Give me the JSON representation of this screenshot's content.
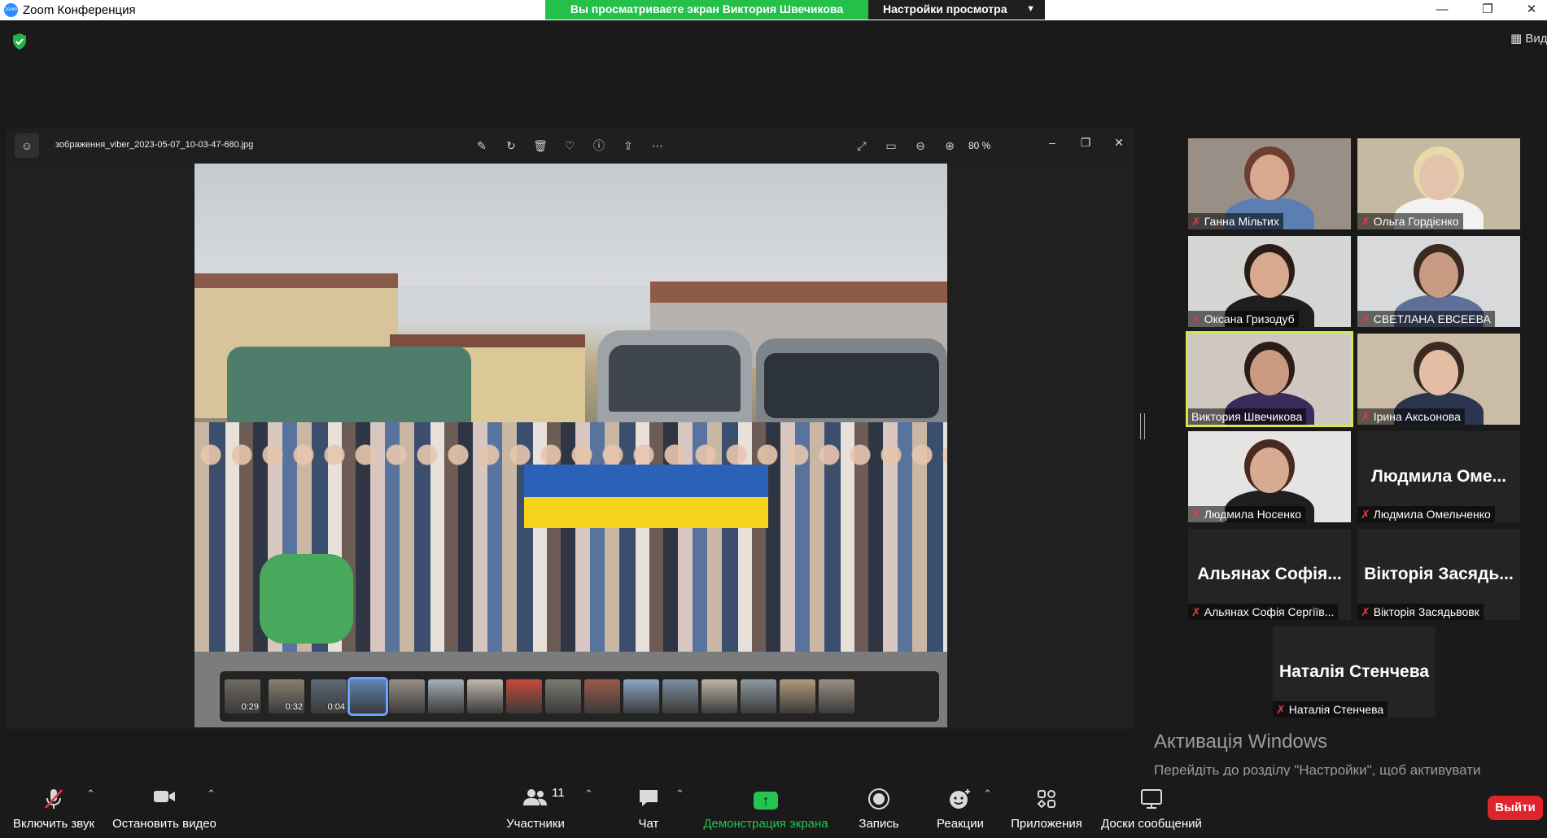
{
  "window": {
    "title": "Zoom Конференция",
    "logo_text": "zoom",
    "minimize": "—",
    "restore": "❐",
    "close": "✕"
  },
  "share": {
    "banner": "Вы просматриваете экран Виктория Швечикова",
    "view_options": "Настройки просмотра"
  },
  "top_right": {
    "view_label": "Вид"
  },
  "viewer": {
    "filename": "зображення_viber_2023-05-07_10-03-47-680.jpg",
    "zoom": "80 %",
    "thumbnails": [
      {
        "label": "0:29",
        "color": "#6f6a63",
        "selected": false
      },
      {
        "label": "0:32",
        "color": "#8b7f70",
        "selected": false
      },
      {
        "label": "0:04",
        "color": "#5d6a76",
        "selected": false
      },
      {
        "label": "",
        "color": "#5f84b4",
        "selected": true
      },
      {
        "label": "",
        "color": "#9a8f87",
        "selected": false
      },
      {
        "label": "",
        "color": "#a7b0b8",
        "selected": false
      },
      {
        "label": "",
        "color": "#bfb8ad",
        "selected": false
      },
      {
        "label": "",
        "color": "#c7493c",
        "selected": false
      },
      {
        "label": "",
        "color": "#7d7a73",
        "selected": false
      },
      {
        "label": "",
        "color": "#9a5b4a",
        "selected": false
      },
      {
        "label": "",
        "color": "#8da6c7",
        "selected": false
      },
      {
        "label": "",
        "color": "#7c8ea0",
        "selected": false
      },
      {
        "label": "",
        "color": "#c0b3a4",
        "selected": false
      },
      {
        "label": "",
        "color": "#8e9aa0",
        "selected": false
      },
      {
        "label": "",
        "color": "#b09a7c",
        "selected": false
      },
      {
        "label": "",
        "color": "#9b8f83",
        "selected": false
      }
    ]
  },
  "participants": [
    {
      "name": "Ганна Мільтих",
      "muted": true,
      "video": true,
      "bg": "#9a8f86",
      "face": "#d9a98f",
      "hair": "#6b3e2f",
      "body": "#5a7fb0"
    },
    {
      "name": "Ольга Гордієнко",
      "muted": true,
      "video": true,
      "bg": "#c6b9a4",
      "face": "#e4c3ad",
      "hair": "#e8d9a8",
      "body": "#f2f2f2"
    },
    {
      "name": "Оксана Гризодуб",
      "muted": true,
      "video": true,
      "bg": "#d6d6d4",
      "face": "#d8a98f",
      "hair": "#2b1c18",
      "body": "#1e1e1e"
    },
    {
      "name": "СВЕТЛАНА ЕВСЕЕВА",
      "muted": true,
      "video": true,
      "bg": "#d8d9da",
      "face": "#c79c82",
      "hair": "#3a2a22",
      "body": "#5e6f9a"
    },
    {
      "name": "Виктория Швечикова",
      "muted": false,
      "video": true,
      "speaking": true,
      "bg": "#cfc8c0",
      "face": "#c99a80",
      "hair": "#2c1c17",
      "body": "#3b2b5a"
    },
    {
      "name": "Ірина Аксьонова",
      "muted": true,
      "video": true,
      "bg": "#cbbca8",
      "face": "#e3bea4",
      "hair": "#3b2a22",
      "body": "#2c3550"
    },
    {
      "name": "Людмила Носенко",
      "muted": true,
      "video": true,
      "bg": "#e6e4e2",
      "face": "#d6ab92",
      "hair": "#4a2a20",
      "body": "#1f1f1f"
    },
    {
      "name": "Людмила Омельченко",
      "muted": true,
      "video": false,
      "display": "Людмила Оме..."
    },
    {
      "name": "Альянах Софія Сергіїв...",
      "muted": true,
      "video": false,
      "display": "Альянах Софія..."
    },
    {
      "name": "Вікторія Засядьвовк",
      "muted": true,
      "video": false,
      "display": "Вікторія Засядь..."
    },
    {
      "name": "Наталія Стенчева",
      "muted": true,
      "video": false,
      "display": "Наталія Стенчева"
    }
  ],
  "activation": {
    "title": "Активація Windows",
    "message": "Перейдіть до розділу \"Настройки\", щоб активувати Windows."
  },
  "toolbar": {
    "audio": "Включить звук",
    "video": "Остановить видео",
    "participants": "Участники",
    "participants_count": "11",
    "chat": "Чат",
    "share": "Демонстрация экрана",
    "record": "Запись",
    "reactions": "Реакции",
    "apps": "Приложения",
    "whiteboards": "Доски сообщений",
    "leave": "Выйти"
  },
  "colors": {
    "share_green": "#25c04a",
    "leave_red": "#e0242c",
    "speaking_outline": "#d7e84b",
    "mute_red": "#e6394a"
  }
}
